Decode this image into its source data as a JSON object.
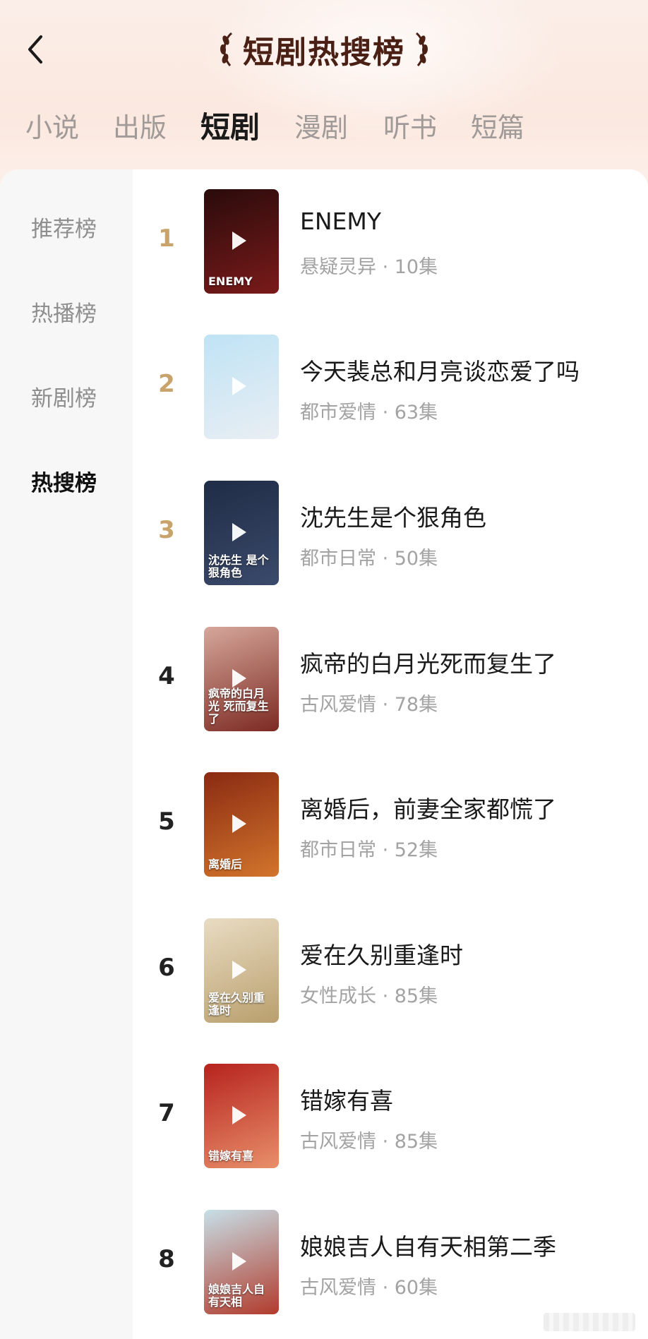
{
  "header": {
    "title": "短剧热搜榜",
    "back_icon": "chevron-left-icon"
  },
  "tabs": [
    {
      "label": "小说",
      "active": false
    },
    {
      "label": "出版",
      "active": false
    },
    {
      "label": "短剧",
      "active": true
    },
    {
      "label": "漫剧",
      "active": false
    },
    {
      "label": "听书",
      "active": false
    },
    {
      "label": "短篇",
      "active": false
    }
  ],
  "sidebar": {
    "items": [
      {
        "label": "推荐榜",
        "active": false
      },
      {
        "label": "热播榜",
        "active": false
      },
      {
        "label": "新剧榜",
        "active": false
      },
      {
        "label": "热搜榜",
        "active": true
      }
    ]
  },
  "rankings": [
    {
      "rank": "1",
      "title": "ENEMY",
      "genre": "悬疑灵异",
      "episodes": "10集",
      "meta": "悬疑灵异 · 10集",
      "cover_colors": [
        "#2a0b0b",
        "#7a1a1a"
      ],
      "cover_caption": "ENEMY"
    },
    {
      "rank": "2",
      "title": "今天裴总和月亮谈恋爱了吗",
      "genre": "都市爱情",
      "episodes": "63集",
      "meta": "都市爱情 · 63集",
      "cover_colors": [
        "#bfe3f5",
        "#e9eef3"
      ],
      "cover_caption": ""
    },
    {
      "rank": "3",
      "title": "沈先生是个狠角色",
      "genre": "都市日常",
      "episodes": "50集",
      "meta": "都市日常 · 50集",
      "cover_colors": [
        "#1f2c46",
        "#3b4a6b"
      ],
      "cover_caption": "沈先生 是个狠角色"
    },
    {
      "rank": "4",
      "title": "疯帝的白月光死而复生了",
      "genre": "古风爱情",
      "episodes": "78集",
      "meta": "古风爱情 · 78集",
      "cover_colors": [
        "#d6a79b",
        "#7c2a22"
      ],
      "cover_caption": "疯帝的白月光 死而复生了"
    },
    {
      "rank": "5",
      "title": "离婚后，前妻全家都慌了",
      "genre": "都市日常",
      "episodes": "52集",
      "meta": "都市日常 · 52集",
      "cover_colors": [
        "#8a2a12",
        "#d2752c"
      ],
      "cover_caption": "离婚后"
    },
    {
      "rank": "6",
      "title": "爱在久别重逢时",
      "genre": "女性成长",
      "episodes": "85集",
      "meta": "女性成长 · 85集",
      "cover_colors": [
        "#e9dcc3",
        "#b99f6d"
      ],
      "cover_caption": "爱在久别重逢时"
    },
    {
      "rank": "7",
      "title": "错嫁有喜",
      "genre": "古风爱情",
      "episodes": "85集",
      "meta": "古风爱情 · 85集",
      "cover_colors": [
        "#b6231e",
        "#e88f6a"
      ],
      "cover_caption": "错嫁有喜"
    },
    {
      "rank": "8",
      "title": "娘娘吉人自有天相第二季",
      "genre": "古风爱情",
      "episodes": "60集",
      "meta": "古风爱情 · 60集",
      "cover_colors": [
        "#c7e0e8",
        "#b13b2c"
      ],
      "cover_caption": "娘娘吉人自有天相"
    }
  ],
  "colors": {
    "top_rank": "#c8a46c",
    "title_brown": "#4a1f14",
    "muted": "#a3a3a3"
  }
}
